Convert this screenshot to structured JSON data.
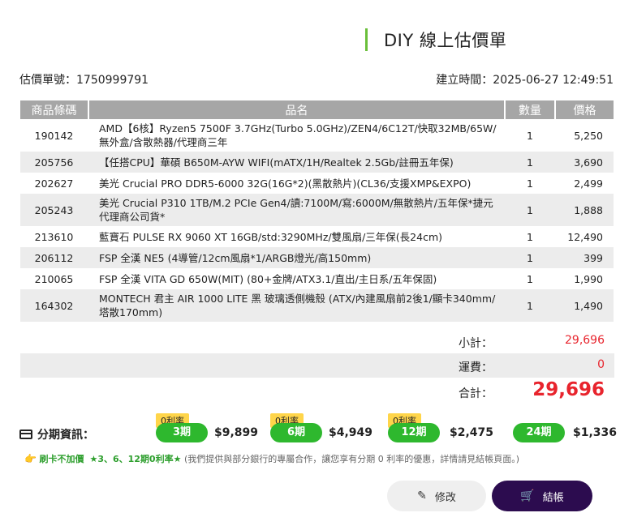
{
  "title": "DIY 線上估價單",
  "meta": {
    "quote_no_label": "估價單號：",
    "quote_no": "1750999791",
    "created_label": "建立時間：",
    "created": "2025-06-27 12:49:51"
  },
  "table": {
    "headers": [
      "商品條碼",
      "品名",
      "數量",
      "價格"
    ],
    "rows": [
      {
        "code": "190142",
        "name": "AMD【6核】Ryzen5 7500F 3.7GHz(Turbo 5.0GHz)/ZEN4/6C12T/快取32MB/65W/無外盒/含散熱器/代理商三年",
        "qty": "1",
        "price": "5,250"
      },
      {
        "code": "205756",
        "name": "【任搭CPU】華碩 B650M-AYW WIFI(mATX/1H/Realtek 2.5Gb/註冊五年保)",
        "qty": "1",
        "price": "3,690"
      },
      {
        "code": "202627",
        "name": "美光 Crucial PRO DDR5-6000 32G(16G*2)(黑散熱片)(CL36/支援XMP&EXPO)",
        "qty": "1",
        "price": "2,499"
      },
      {
        "code": "205243",
        "name": "美光 Crucial P310 1TB/M.2 PCIe Gen4/讀:7100M/寫:6000M/無散熱片/五年保*捷元代理商公司貨*",
        "qty": "1",
        "price": "1,888"
      },
      {
        "code": "213610",
        "name": "藍寶石 PULSE RX 9060 XT 16GB/std:3290MHz/雙風扇/三年保(長24cm)",
        "qty": "1",
        "price": "12,490"
      },
      {
        "code": "206112",
        "name": "FSP 全漢 NE5 (4導管/12cm風扇*1/ARGB燈光/高150mm)",
        "qty": "1",
        "price": "399"
      },
      {
        "code": "210065",
        "name": "FSP 全漢 VITA GD 650W(MIT) (80+金牌/ATX3.1/直出/主日系/五年保固)",
        "qty": "1",
        "price": "1,990"
      },
      {
        "code": "164302",
        "name": "MONTECH 君主 AIR 1000 LITE 黑 玻璃透側機殼 (ATX/內建風扇前2後1/顯卡340mm/塔散170mm)",
        "qty": "1",
        "price": "1,490"
      }
    ]
  },
  "summary": {
    "subtotal_label": "小計：",
    "subtotal": "29,696",
    "shipping_label": "運費：",
    "shipping": "0",
    "total_label": "合計：",
    "total": "29,696"
  },
  "installments": {
    "label": "分期資訊：",
    "options": [
      {
        "tag": "0利率",
        "period": "3期",
        "amount": "$9,899"
      },
      {
        "tag": "0利率",
        "period": "6期",
        "amount": "$4,949"
      },
      {
        "tag": "0利率",
        "period": "12期",
        "amount": "$2,475"
      },
      {
        "tag": "",
        "period": "24期",
        "amount": "$1,336"
      }
    ]
  },
  "note": {
    "hand": "👉",
    "text1": "刷卡不加價",
    "text2": "★3、6、12期0利率★",
    "text3": "(我們提供與部分銀行的專屬合作，讓您享有分期 0 利率的優惠，詳情請見結帳頁面。)"
  },
  "buttons": {
    "edit": "修改",
    "checkout": "結帳"
  },
  "colors": {
    "accent_green": "#2eb82e",
    "price_red": "#e8242d",
    "checkout_bg": "#2c0c4f",
    "tag_yellow": "#ffd54a"
  }
}
